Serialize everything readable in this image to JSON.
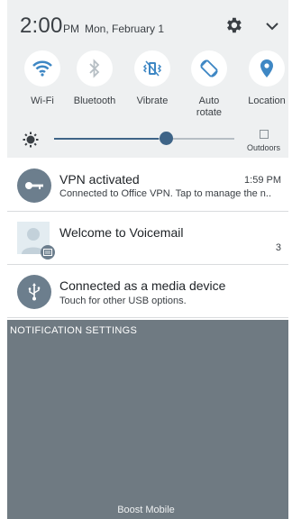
{
  "status": {
    "time": "2:00",
    "ampm": "PM",
    "date": "Mon, February 1"
  },
  "header_icons": {
    "settings": "gear-icon",
    "expand": "chevron-down-icon"
  },
  "quick_toggles": [
    {
      "label": "Wi-Fi",
      "icon": "wifi-icon",
      "active": true
    },
    {
      "label": "Bluetooth",
      "icon": "bluetooth-icon",
      "active": false
    },
    {
      "label": "Vibrate",
      "icon": "vibrate-icon",
      "active": true
    },
    {
      "label": "Auto rotate",
      "label_line1": "Auto",
      "label_line2": "rotate",
      "icon": "auto-rotate-icon",
      "active": true
    },
    {
      "label": "Location",
      "icon": "location-icon",
      "active": true
    }
  ],
  "brightness": {
    "level": 0.58,
    "outdoors_label": "Outdoors",
    "outdoors_checked": false
  },
  "notifications": [
    {
      "title": "VPN activated",
      "time": "1:59 PM",
      "text": "Connected to Office VPN. Tap to manage the n..",
      "icon": "key-icon"
    },
    {
      "title": "Welcome to Voicemail",
      "count": "3",
      "icon": "voicemail-avatar-icon"
    },
    {
      "title": "Connected as a media device",
      "text": "Touch for other USB options.",
      "icon": "usb-icon"
    }
  ],
  "notification_settings_label": "NOTIFICATION SETTINGS",
  "carrier": "Boost Mobile",
  "colors": {
    "accent": "#3e6487",
    "header_bg": "#eef0f1",
    "shade_bg": "#6f7a82",
    "icon_bg": "#6c7e8d"
  }
}
